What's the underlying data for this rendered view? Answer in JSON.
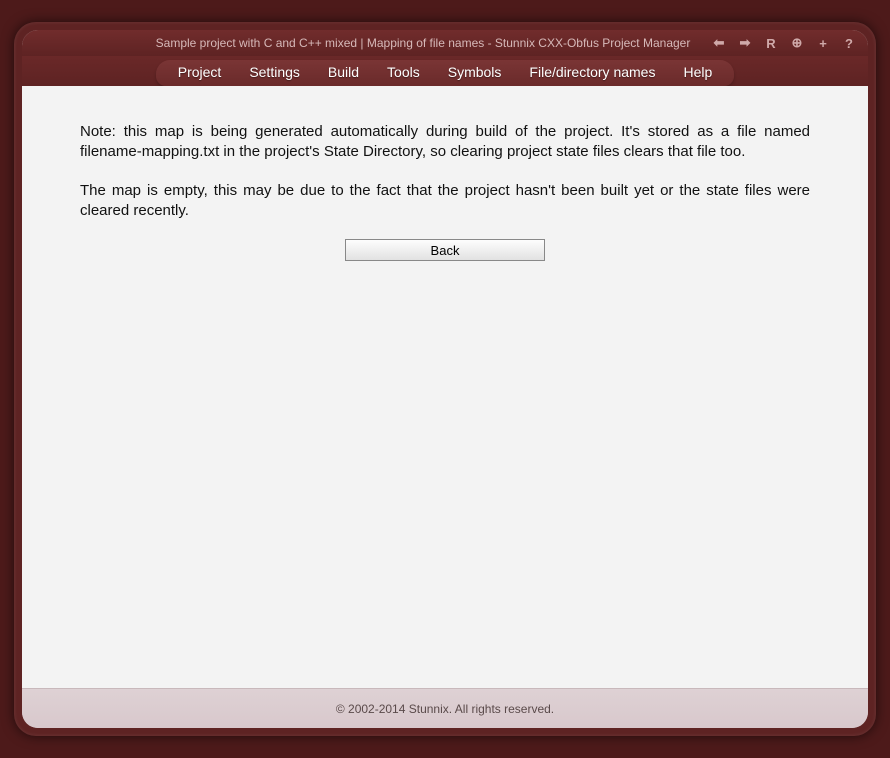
{
  "titlebar": {
    "title": "Sample project with C and C++ mixed | Mapping of file names - Stunnix CXX-Obfus Project Manager"
  },
  "menubar": {
    "items": [
      "Project",
      "Settings",
      "Build",
      "Tools",
      "Symbols",
      "File/directory names",
      "Help"
    ]
  },
  "content": {
    "note": "Note: this map is being generated automatically during build of the project. It's stored as a file named filename-mapping.txt in the project's State Directory, so clearing project state files clears that file too.",
    "empty_msg": "The map is empty, this may be due to the fact that the project hasn't been built yet or the state files were cleared recently.",
    "back_label": "Back"
  },
  "footer": {
    "copyright": "© 2002-2014 Stunnix. All rights reserved."
  }
}
